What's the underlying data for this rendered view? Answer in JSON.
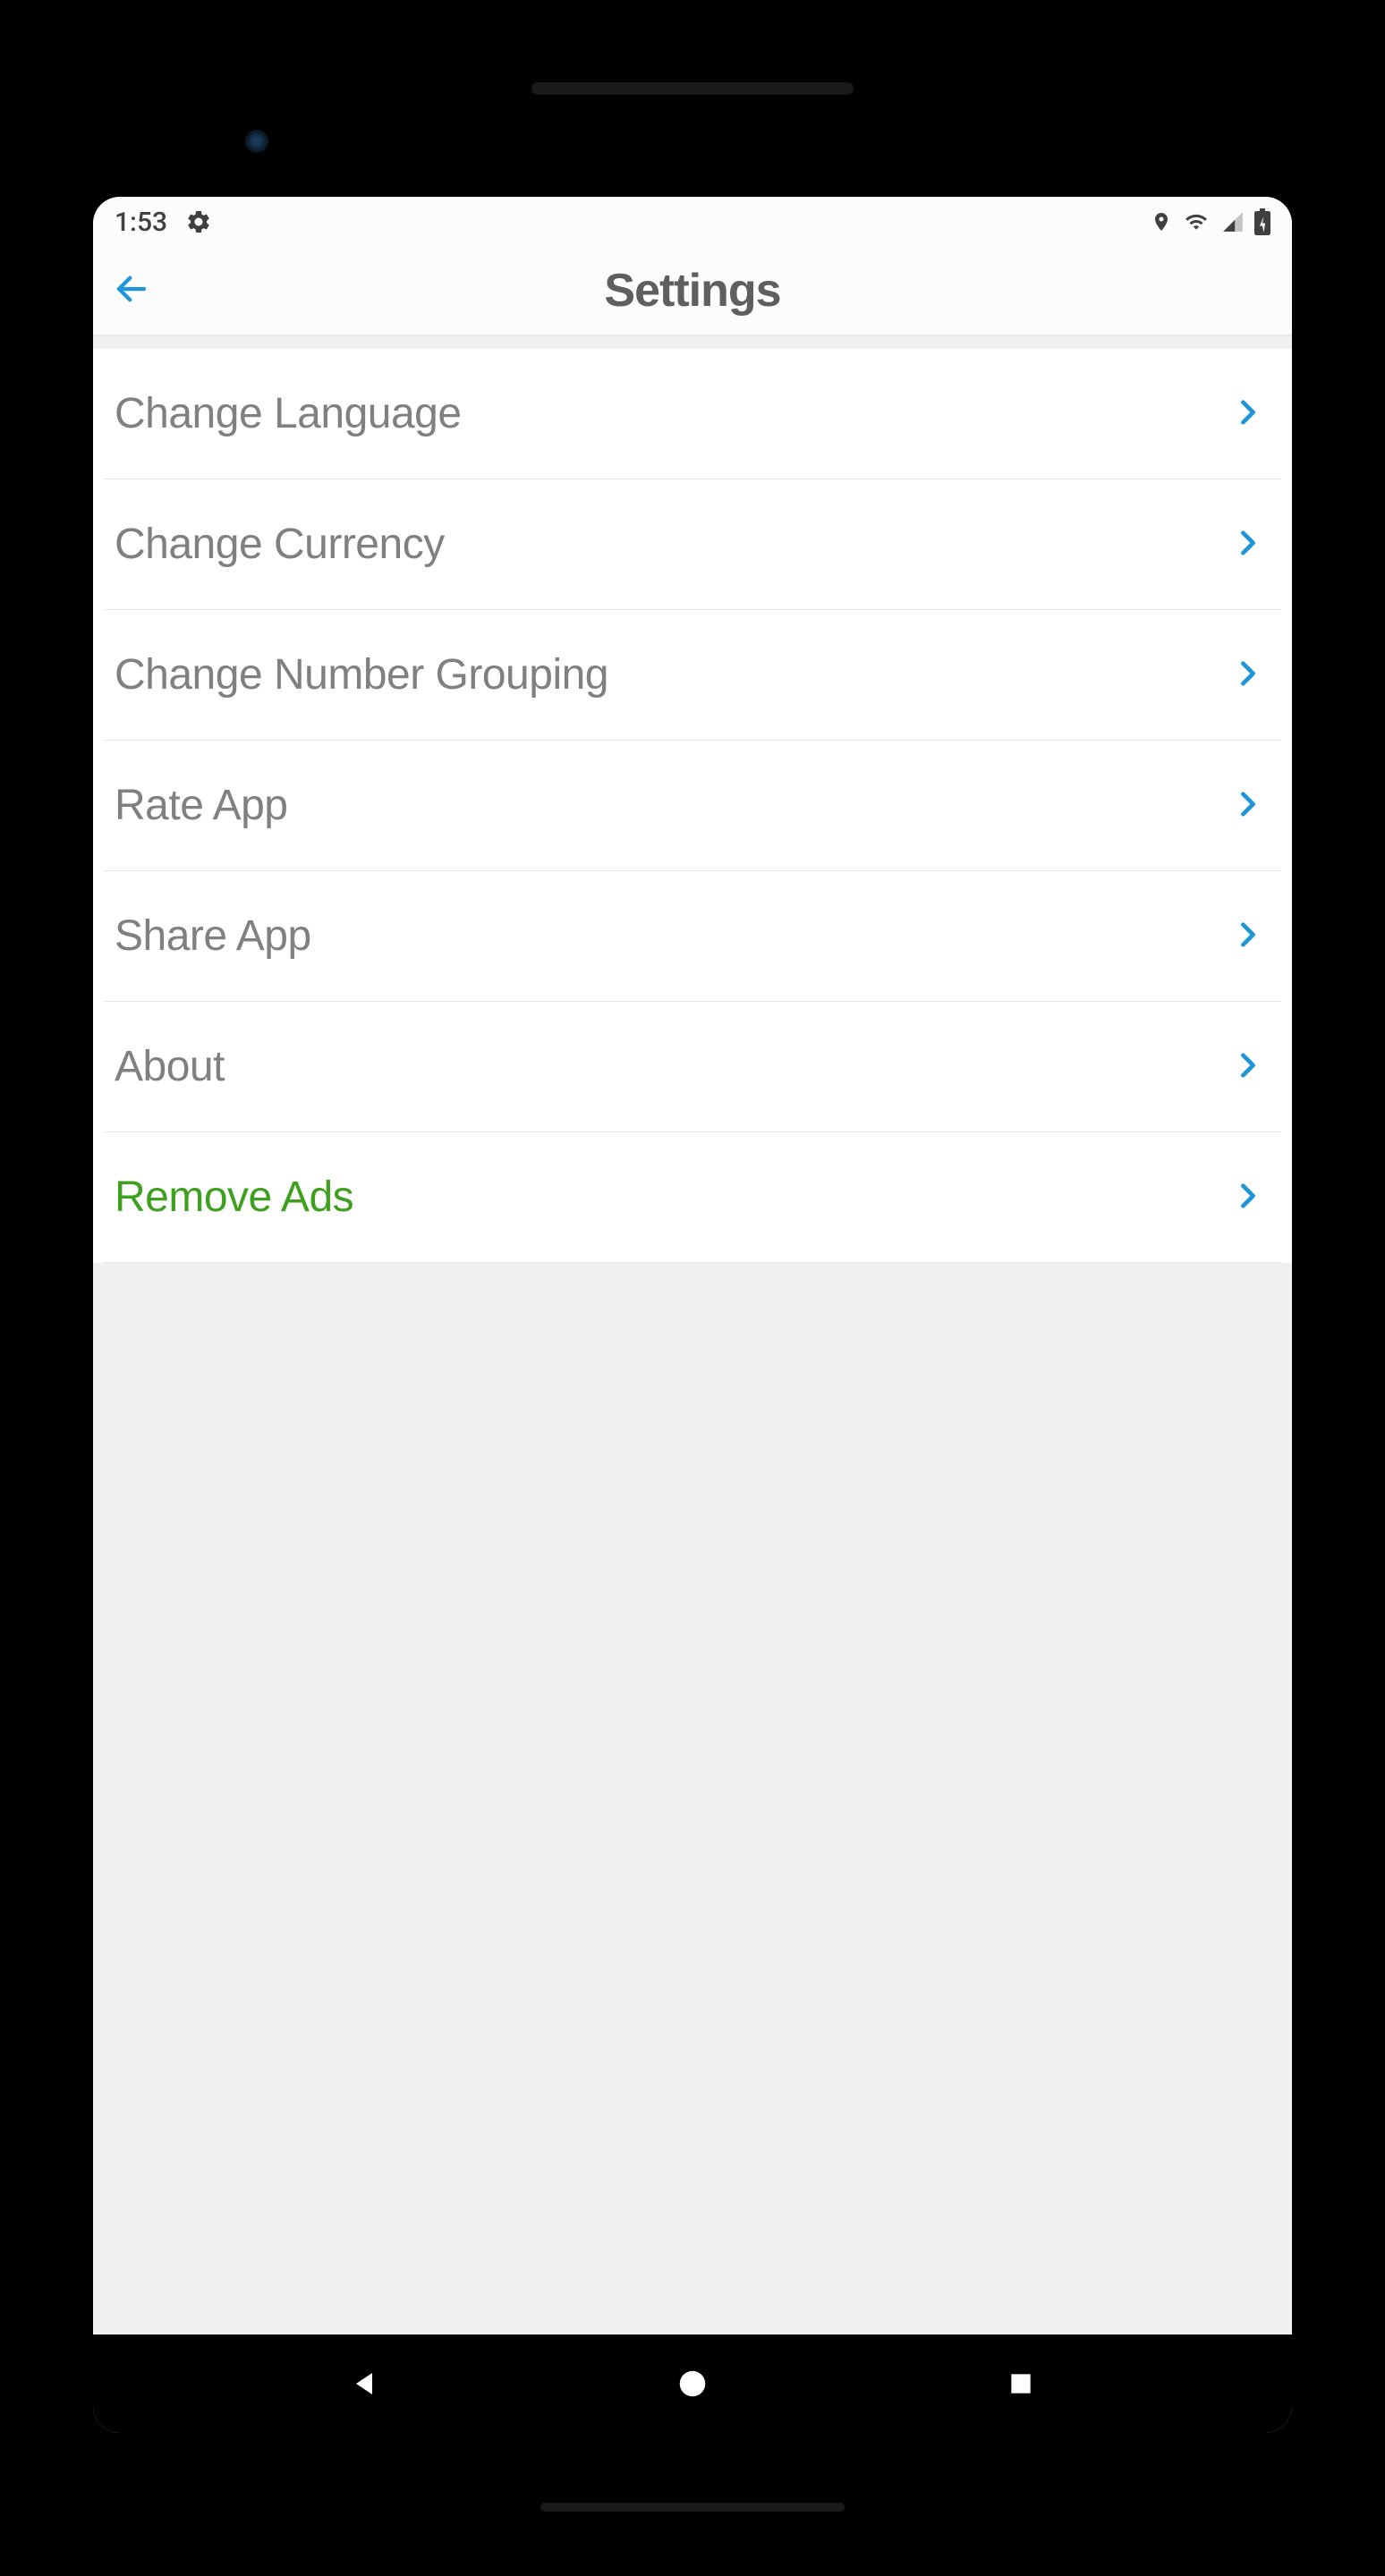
{
  "status_bar": {
    "time": "1:53"
  },
  "header": {
    "title": "Settings"
  },
  "settings": {
    "items": [
      {
        "label": "Change Language",
        "highlight": false
      },
      {
        "label": "Change Currency",
        "highlight": false
      },
      {
        "label": "Change Number Grouping",
        "highlight": false
      },
      {
        "label": "Rate App",
        "highlight": false
      },
      {
        "label": "Share App",
        "highlight": false
      },
      {
        "label": "About",
        "highlight": false
      },
      {
        "label": "Remove Ads",
        "highlight": true
      }
    ]
  },
  "colors": {
    "accent_blue": "#2196d6",
    "highlight_green": "#3fa020",
    "text_gray": "#808080",
    "header_gray": "#5f5f5f"
  }
}
